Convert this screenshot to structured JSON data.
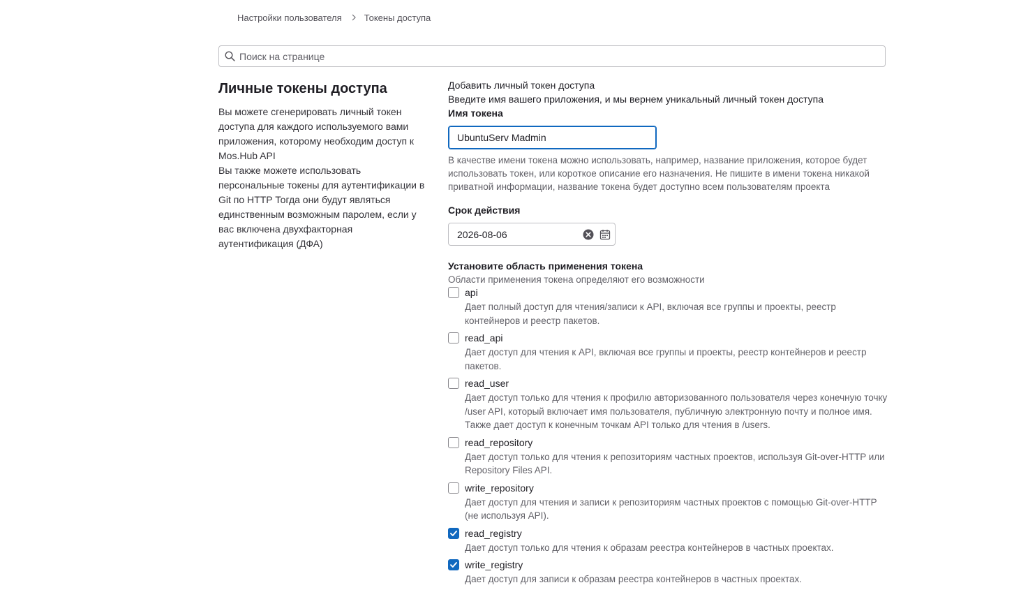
{
  "breadcrumb": {
    "items": [
      "Настройки пользователя",
      "Токены доступа"
    ]
  },
  "search": {
    "placeholder": "Поиск на странице"
  },
  "intro": {
    "title": "Личные токены доступа",
    "paragraph1": "Вы можете сгенерировать личный токен доступа для каждого используемого вами приложения, которому необходим доступ к Mos.Hub API",
    "paragraph2": "Вы также можете использовать персональные токены для аутентификации в Git по HTTP Тогда они будут являться единственным возможным паролем, если у вас включена двухфакторная аутентификация (ДФА)"
  },
  "form": {
    "title": "Добавить личный токен доступа",
    "description": "Введите имя вашего приложения, и мы вернем уникальный личный токен доступа",
    "name_label": "Имя токена",
    "name_value": "UbuntuServ Madmin",
    "name_help": "В качестве имени токена можно использовать, например, название приложения, которое будет использовать токен, или короткое описание его назначения. Не пишите в имени токена никакой приватной информации, название токена будет доступно всем пользователям проекта",
    "expiry_label": "Срок действия",
    "expiry_value": "2026-08-06",
    "scopes_label": "Установите область применения токена",
    "scopes_help": "Области применения токена определяют его возможности",
    "scopes": [
      {
        "name": "api",
        "checked": false,
        "description": "Дает полный доступ для чтения/записи к API, включая все группы и проекты, реестр контейнеров и реестр пакетов."
      },
      {
        "name": "read_api",
        "checked": false,
        "description": "Дает доступ для чтения к API, включая все группы и проекты, реестр контейнеров и реестр пакетов."
      },
      {
        "name": "read_user",
        "checked": false,
        "description": "Дает доступ только для чтения к профилю авторизованного пользователя через конечную точку /user API, который включает имя пользователя, публичную электронную почту и полное имя. Также дает доступ к конечным точкам API только для чтения в /users."
      },
      {
        "name": "read_repository",
        "checked": false,
        "description": "Дает доступ только для чтения к репозиториям частных проектов, используя Git-over-HTTP или Repository Files API."
      },
      {
        "name": "write_repository",
        "checked": false,
        "description": "Дает доступ для чтения и записи к репозиториям частных проектов с помощью Git-over-HTTP (не используя API)."
      },
      {
        "name": "read_registry",
        "checked": true,
        "description": "Дает доступ только для чтения к образам реестра контейнеров в частных проектах."
      },
      {
        "name": "write_registry",
        "checked": true,
        "description": "Дает доступ для записи к образам реестра контейнеров в частных проектах."
      }
    ]
  },
  "colors": {
    "accent": "#1068bf",
    "text": "#1f1e24",
    "muted": "#626168",
    "border": "#bfbfc3"
  }
}
